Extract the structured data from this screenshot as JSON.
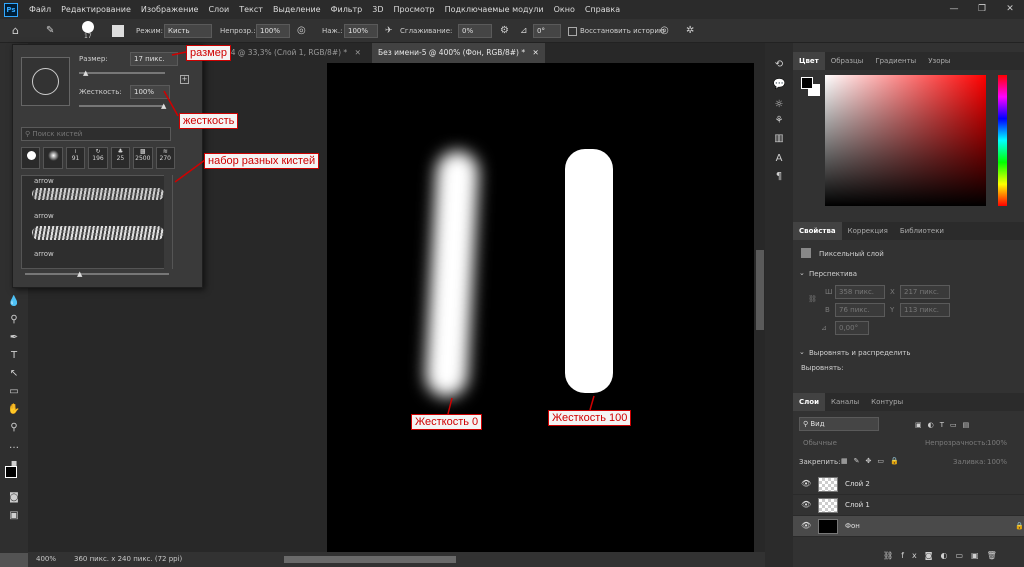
{
  "menu": {
    "logo": "Ps",
    "items": [
      "Файл",
      "Редактирование",
      "Изображение",
      "Слои",
      "Текст",
      "Выделение",
      "Фильтр",
      "3D",
      "Просмотр",
      "Подключаемые модули",
      "Окно",
      "Справка"
    ],
    "win_minimize": "—",
    "win_restore": "❐",
    "win_close": "✕"
  },
  "options": {
    "brush_size": "17",
    "mode_label": "Режим:",
    "mode_value": "Кисть",
    "opacity_label": "Непрозр.:",
    "opacity_value": "100%",
    "flow_label": "Наж.:",
    "flow_value": "100%",
    "smoothing_label": "Сглаживание:",
    "smoothing_value": "0%",
    "angle_value": "0°",
    "restore_history": "Восстановить историю"
  },
  "tabs": [
    {
      "label": "мени-4 @ 33,3% (Слой 1, RGB/8#) *",
      "close": "✕"
    },
    {
      "label": "Без имени-5 @ 400% (Фон, RGB/8#) *",
      "close": "✕"
    }
  ],
  "status": {
    "zoom": "400%",
    "doc_info": "360 пикс. x 240 пикс. (72 ppi)"
  },
  "brush_panel": {
    "size_label": "Размер:",
    "size_value": "17 пикс.",
    "hardness_label": "Жесткость:",
    "hardness_value": "100%",
    "search_placeholder": "Поиск кистей",
    "presets": [
      "",
      "",
      "91",
      "196",
      "25",
      "2500",
      "270"
    ],
    "brush_names": [
      "arrow",
      "arrow",
      "arrow"
    ]
  },
  "callouts": {
    "size": "размер",
    "hardness": "жесткость",
    "brush_set": "набор разных кистей",
    "hardness0": "Жесткость 0",
    "hardness100": "Жесткость 100"
  },
  "right": {
    "color_tabs": [
      "Цвет",
      "Образцы",
      "Градиенты",
      "Узоры"
    ],
    "props_tabs": [
      "Свойства",
      "Коррекция",
      "Библиотеки"
    ],
    "pixel_layer": "Пиксельный слой",
    "perspective": "Перспектива",
    "w_label": "Ш",
    "w_value": "358 пикс.",
    "h_label": "В",
    "h_value": "76 пикс.",
    "x_label": "X",
    "x_value": "217 пикс.",
    "y_label": "Y",
    "y_value": "113 пикс.",
    "angle_value": "0,00°",
    "align_title": "Выровнять и распределить",
    "align_label": "Выровнять:",
    "layers_tabs": [
      "Слои",
      "Каналы",
      "Контуры"
    ],
    "kind_filter": "Вид",
    "blend_mode": "Обычные",
    "opacity_label": "Непрозрачность:",
    "opacity_value": "100%",
    "lock_label": "Закрепить:",
    "fill_label": "Заливка:",
    "fill_value": "100%",
    "layers": [
      "Слой 2",
      "Слой 1",
      "Фон"
    ]
  },
  "colors": {
    "accent": "#31a8ff",
    "callout_red": "#d00000"
  }
}
